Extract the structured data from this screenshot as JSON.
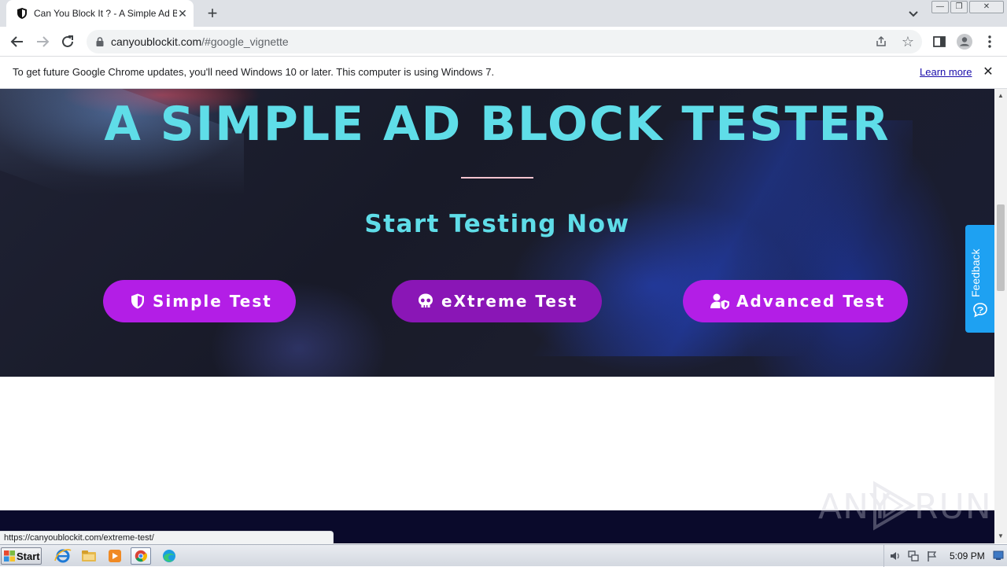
{
  "browser": {
    "tab": {
      "title": "Can You Block It ? - A Simple Ad Blocker Tester"
    },
    "address_bar": {
      "url_host": "canyoublockit.com",
      "url_path": "/#google_vignette"
    }
  },
  "infobar": {
    "message": "To get future Google Chrome updates, you'll need Windows 10 or later. This computer is using Windows 7.",
    "link_label": "Learn more"
  },
  "hero": {
    "title": "A SIMPLE AD BLOCK TESTER",
    "subtitle": "Start Testing Now",
    "buttons": [
      {
        "label": "Simple Test",
        "icon": "shield-icon"
      },
      {
        "label": "eXtreme Test",
        "icon": "skull-icon"
      },
      {
        "label": "Advanced Test",
        "icon": "user-shield-icon"
      }
    ]
  },
  "feedback": {
    "label": "Feedback"
  },
  "watermark": {
    "left": "ANY",
    "right": "RUN"
  },
  "status_bar": {
    "url": "https://canyoublockit.com/extreme-test/"
  },
  "taskbar": {
    "start_label": "Start",
    "clock": "5:09 PM"
  },
  "colors": {
    "accent_cyan": "#5fdde8",
    "button_purple": "#b31ee6",
    "button_purple_hover": "#8a16b6",
    "feedback_blue": "#1ea1f2"
  }
}
